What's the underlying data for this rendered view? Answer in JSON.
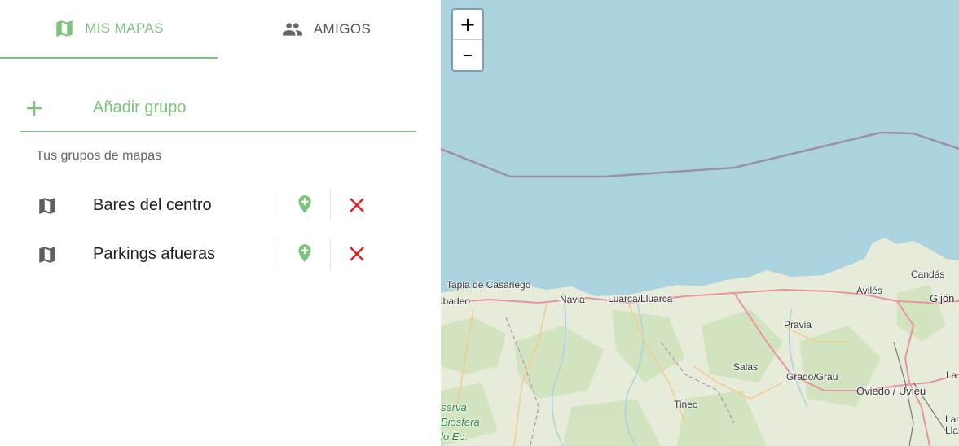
{
  "tabs": [
    {
      "label": "MIS MAPAS",
      "icon": "map-icon",
      "active": true
    },
    {
      "label": "AMIGOS",
      "icon": "people-icon",
      "active": false
    }
  ],
  "add_group": {
    "label": "Añadir grupo",
    "icon": "plus-icon"
  },
  "groups_section_label": "Tus grupos de mapas",
  "groups": [
    {
      "name": "Bares del centro"
    },
    {
      "name": "Parkings afueras"
    }
  ],
  "map": {
    "zoom_in": "+",
    "zoom_out": "–",
    "places": [
      {
        "name": "Tapia de Casariego"
      },
      {
        "name": "ibadeo"
      },
      {
        "name": "Navia"
      },
      {
        "name": "Luarca/Lluarca"
      },
      {
        "name": "Avilés"
      },
      {
        "name": "Candás"
      },
      {
        "name": "Gijón"
      },
      {
        "name": "Pravia"
      },
      {
        "name": "Salas"
      },
      {
        "name": "Grado/Grau"
      },
      {
        "name": "Oviedo / Uviéu"
      },
      {
        "name": "La P"
      },
      {
        "name": "Tineo"
      },
      {
        "name": "Lang"
      },
      {
        "name": "Llane"
      },
      {
        "name": "serva"
      },
      {
        "name": "Biosfera"
      },
      {
        "name": "lo Eo."
      }
    ]
  },
  "colors": {
    "accent": "#7cc37e",
    "delete": "#e02020",
    "sea": "#aad3df",
    "land": "#e6ecd9"
  }
}
